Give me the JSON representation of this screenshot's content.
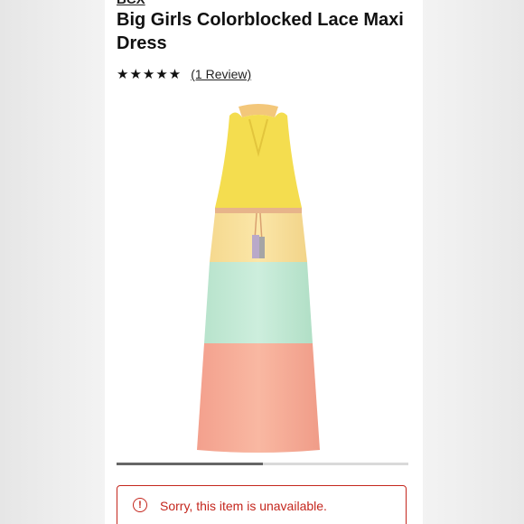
{
  "product": {
    "brand": "BCX",
    "title": "Big Girls Colorblocked Lace Maxi Dress",
    "stars": "★★★★★",
    "review_link": "(1 Review)",
    "rating": 5,
    "rating_max": 5
  },
  "gallery": {
    "progress": 0.5
  },
  "alert": {
    "icon": "alert-circle-icon",
    "icon_glyph": "!",
    "message": "Sorry, this item is unavailable.",
    "color": "#c4261d"
  }
}
